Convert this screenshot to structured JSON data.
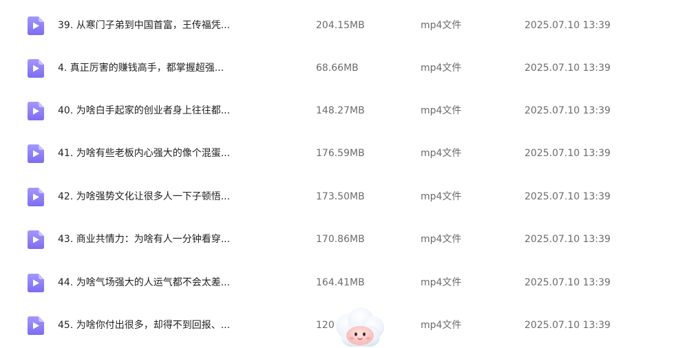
{
  "icons": {
    "file": "video-file-icon",
    "assistant": "cloud-assistant-icon"
  },
  "colors": {
    "icon_top": "#a597ff",
    "icon_bottom": "#7c6cf4"
  },
  "files": [
    {
      "name": "39. 从寒门子弟到中国首富，王传福凭...",
      "size": "204.15MB",
      "type": "mp4文件",
      "date": "2025.07.10 13:39"
    },
    {
      "name": "4. 真正厉害的赚钱高手，都掌握超强...",
      "size": "68.66MB",
      "type": "mp4文件",
      "date": "2025.07.10 13:39"
    },
    {
      "name": "40. 为啥白手起家的创业者身上往往都...",
      "size": "148.27MB",
      "type": "mp4文件",
      "date": "2025.07.10 13:39"
    },
    {
      "name": "41. 为啥有些老板内心强大的像个混蛋...",
      "size": "176.59MB",
      "type": "mp4文件",
      "date": "2025.07.10 13:39"
    },
    {
      "name": "42. 为啥强势文化让很多人一下子顿悟...",
      "size": "173.50MB",
      "type": "mp4文件",
      "date": "2025.07.10 13:39"
    },
    {
      "name": "43. 商业共情力：为啥有人一分钟看穿...",
      "size": "170.86MB",
      "type": "mp4文件",
      "date": "2025.07.10 13:39"
    },
    {
      "name": "44. 为啥气场强大的人运气都不会太差...",
      "size": "164.41MB",
      "type": "mp4文件",
      "date": "2025.07.10 13:39"
    },
    {
      "name": "45. 为啥你付出很多，却得不到回报、...",
      "size": "120",
      "type": "mp4文件",
      "date": "2025.07.10 13:39"
    }
  ]
}
